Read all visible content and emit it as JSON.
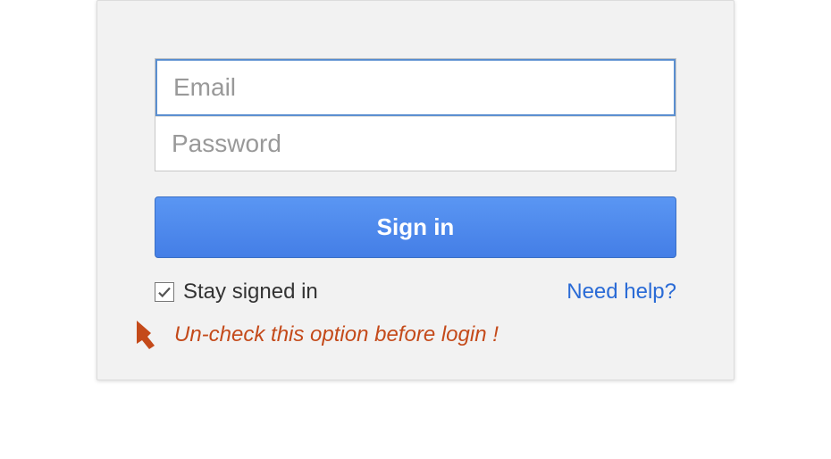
{
  "form": {
    "email_placeholder": "Email",
    "email_value": "",
    "password_placeholder": "Password",
    "password_value": "",
    "signin_label": "Sign in",
    "stay_signed_in_label": "Stay signed in",
    "stay_signed_in_checked": true,
    "help_link_label": "Need help?"
  },
  "annotation": {
    "text": "Un-check this option before login !"
  },
  "colors": {
    "primary": "#4d8ef0",
    "link": "#2a6bd6",
    "annotation": "#c44a1a"
  }
}
